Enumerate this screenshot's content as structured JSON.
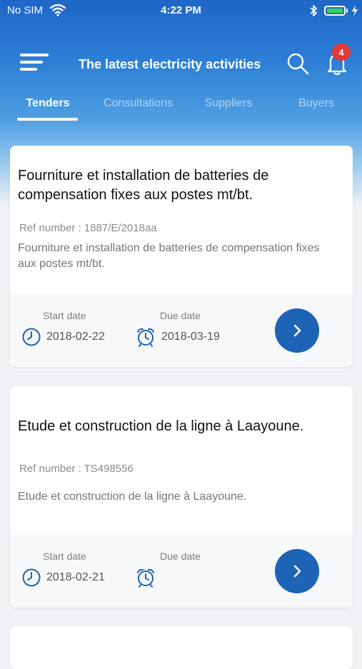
{
  "status_bar": {
    "carrier": "No SIM",
    "time": "4:22 PM"
  },
  "header": {
    "title": "The latest electricity activities",
    "notification_count": "4",
    "menu_icon": "hamburger-menu-icon",
    "search_icon": "search-icon",
    "bell_icon": "bell-icon"
  },
  "tabs": [
    {
      "label": "Tenders",
      "active": true
    },
    {
      "label": "Consultations",
      "active": false
    },
    {
      "label": "Suppliers",
      "active": false
    },
    {
      "label": "Buyers",
      "active": false
    }
  ],
  "colors": {
    "primary": "#1d63b6",
    "badge": "#e53935",
    "header_top": "#1f66c6"
  },
  "cards": [
    {
      "title": "Fourniture et installation de batteries de compensation fixes aux postes mt/bt.",
      "ref": "Ref number : 1887/E/2018aa",
      "description": "Fourniture et installation de batteries de compensation fixes aux postes mt/bt.",
      "start_label": "Start date",
      "start_date": "2018-02-22",
      "due_label": "Due date",
      "due_date": "2018-03-19"
    },
    {
      "title": "Etude et construction de la ligne à Laayoune.",
      "ref": "Ref number : TS498556",
      "description": "Etude et construction de la ligne à Laayoune.",
      "start_label": "Start date",
      "start_date": "2018-02-21",
      "due_label": "Due date",
      "due_date": ""
    }
  ]
}
